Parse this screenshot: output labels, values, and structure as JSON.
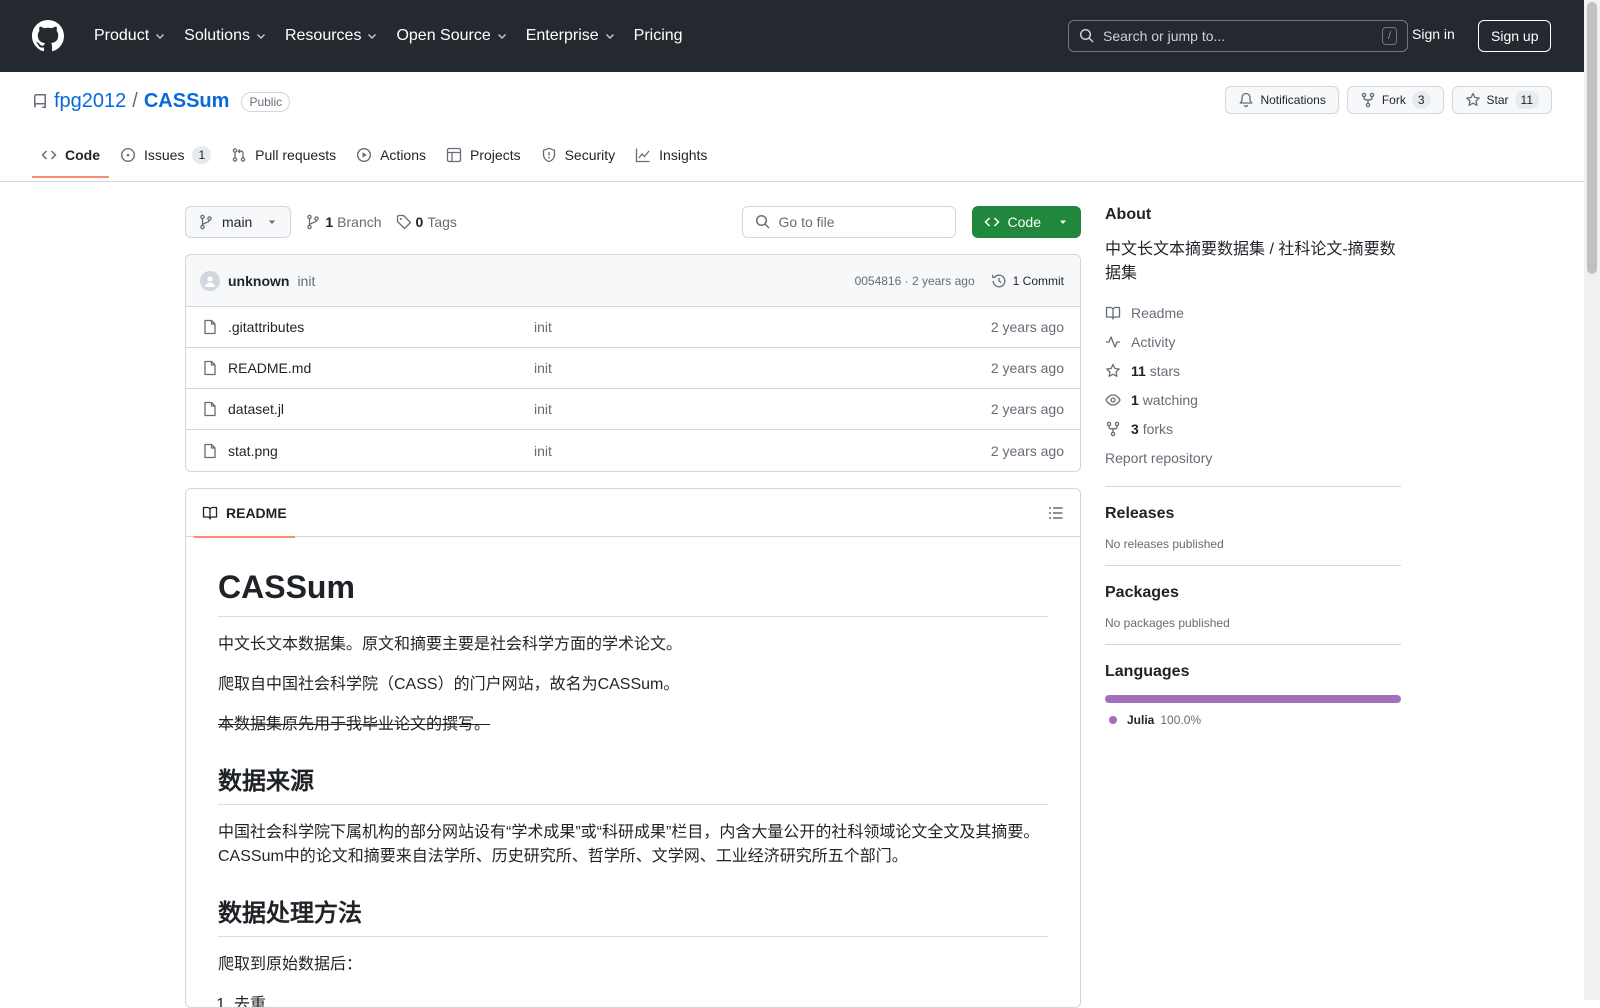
{
  "header": {
    "nav": [
      {
        "label": "Product",
        "has_menu": true
      },
      {
        "label": "Solutions",
        "has_menu": true
      },
      {
        "label": "Resources",
        "has_menu": true
      },
      {
        "label": "Open Source",
        "has_menu": true
      },
      {
        "label": "Enterprise",
        "has_menu": true
      },
      {
        "label": "Pricing",
        "has_menu": false
      }
    ],
    "search_placeholder": "Search or jump to...",
    "search_shortcut": "/",
    "sign_in": "Sign in",
    "sign_up": "Sign up"
  },
  "repo": {
    "owner": "fpg2012",
    "separator": "/",
    "name": "CASSum",
    "visibility": "Public",
    "notifications_label": "Notifications",
    "fork_label": "Fork",
    "fork_count": "3",
    "star_label": "Star",
    "star_count": "11",
    "tabs": [
      {
        "label": "Code",
        "icon": "code-icon",
        "active": true,
        "count": ""
      },
      {
        "label": "Issues",
        "icon": "issue-icon",
        "active": false,
        "count": "1"
      },
      {
        "label": "Pull requests",
        "icon": "pull-request-icon",
        "active": false,
        "count": ""
      },
      {
        "label": "Actions",
        "icon": "play-icon",
        "active": false,
        "count": ""
      },
      {
        "label": "Projects",
        "icon": "table-icon",
        "active": false,
        "count": ""
      },
      {
        "label": "Security",
        "icon": "shield-icon",
        "active": false,
        "count": ""
      },
      {
        "label": "Insights",
        "icon": "graph-icon",
        "active": false,
        "count": ""
      }
    ]
  },
  "toolbar": {
    "branch": "main",
    "branch_count": "1",
    "branch_label": "Branch",
    "tag_count": "0",
    "tag_label": "Tags",
    "goto_placeholder": "Go to file",
    "code_button": "Code"
  },
  "commit": {
    "author": "unknown",
    "message": "init",
    "meta": "0054816 · 2 years ago",
    "count_label": "1 Commit"
  },
  "files": [
    {
      "name": ".gitattributes",
      "message": "init",
      "date": "2 years ago"
    },
    {
      "name": "README.md",
      "message": "init",
      "date": "2 years ago"
    },
    {
      "name": "dataset.jl",
      "message": "init",
      "date": "2 years ago"
    },
    {
      "name": "stat.png",
      "message": "init",
      "date": "2 years ago"
    }
  ],
  "readme": {
    "tab_label": "README",
    "title": "CASSum",
    "p1": "中文长文本数据集。原文和摘要主要是社会科学方面的学术论文。",
    "p2": "爬取自中国社会科学院（CASS）的门户网站，故名为CASSum。",
    "p3": "本数据集原先用于我毕业论文的撰写。",
    "h2_source": "数据来源",
    "p4": "中国社会科学院下属机构的部分网站设有“学术成果”或“科研成果”栏目，内含大量公开的社科领域论文全文及其摘要。CASSum中的论文和摘要来自法学所、历史研究所、哲学所、文学网、工业经济研究所五个部门。",
    "h2_method": "数据处理方法",
    "p5": "爬取到原始数据后：",
    "list_item_1": "去重"
  },
  "about": {
    "heading": "About",
    "description": "中文长文本摘要数据集 / 社科论文-摘要数据集",
    "readme_label": "Readme",
    "activity_label": "Activity",
    "stars_count": "11",
    "stars_label": "stars",
    "watching_count": "1",
    "watching_label": "watching",
    "forks_count": "3",
    "forks_label": "forks",
    "report_label": "Report repository"
  },
  "releases": {
    "heading": "Releases",
    "empty": "No releases published"
  },
  "packages": {
    "heading": "Packages",
    "empty": "No packages published"
  },
  "languages": {
    "heading": "Languages",
    "items": [
      {
        "name": "Julia",
        "percent": "100.0%",
        "color": "#a270ba"
      }
    ]
  }
}
